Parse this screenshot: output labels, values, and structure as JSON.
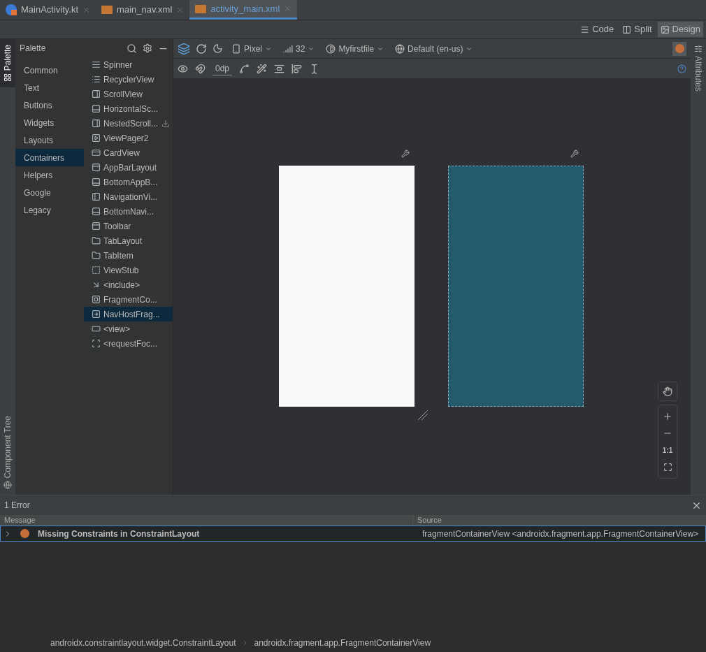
{
  "editor_tabs": [
    {
      "label": "MainActivity.kt",
      "kind": "kotlin",
      "selected": false
    },
    {
      "label": "main_nav.xml",
      "kind": "xml",
      "selected": false
    },
    {
      "label": "activity_main.xml",
      "kind": "xml",
      "selected": true
    }
  ],
  "view_modes": [
    {
      "label": "Code",
      "kind": "code",
      "selected": false
    },
    {
      "label": "Split",
      "kind": "split",
      "selected": false
    },
    {
      "label": "Design",
      "kind": "design",
      "selected": true
    }
  ],
  "left_tool_tabs": [
    {
      "label": "Palette",
      "kind": "palette",
      "selected": true
    },
    {
      "label": "Component Tree",
      "kind": "tree",
      "selected": false
    }
  ],
  "right_tool_tabs": [
    {
      "label": "Attributes",
      "selected": false
    }
  ],
  "palette": {
    "title": "Palette",
    "categories": [
      {
        "label": "Common",
        "selected": false
      },
      {
        "label": "Text",
        "selected": false
      },
      {
        "label": "Buttons",
        "selected": false
      },
      {
        "label": "Widgets",
        "selected": false
      },
      {
        "label": "Layouts",
        "selected": false
      },
      {
        "label": "Containers",
        "selected": true
      },
      {
        "label": "Helpers",
        "selected": false
      },
      {
        "label": "Google",
        "selected": false
      },
      {
        "label": "Legacy",
        "selected": false
      }
    ],
    "items": [
      {
        "label": "Spinner",
        "kind": "spinner",
        "selected": false,
        "download": false
      },
      {
        "label": "RecyclerView",
        "kind": "list",
        "selected": false,
        "download": false
      },
      {
        "label": "ScrollView",
        "kind": "scroll",
        "selected": false,
        "download": false
      },
      {
        "label": "HorizontalSc...",
        "kind": "hscroll",
        "selected": false,
        "download": false
      },
      {
        "label": "NestedScroll...",
        "kind": "scroll",
        "selected": false,
        "download": true
      },
      {
        "label": "ViewPager2",
        "kind": "pager",
        "selected": false,
        "download": false
      },
      {
        "label": "CardView",
        "kind": "card",
        "selected": false,
        "download": false
      },
      {
        "label": "AppBarLayout",
        "kind": "appbar",
        "selected": false,
        "download": false
      },
      {
        "label": "BottomAppB...",
        "kind": "bottombar",
        "selected": false,
        "download": false
      },
      {
        "label": "NavigationVi...",
        "kind": "navview",
        "selected": false,
        "download": false
      },
      {
        "label": "BottomNavi...",
        "kind": "bottombar",
        "selected": false,
        "download": false
      },
      {
        "label": "Toolbar",
        "kind": "appbar",
        "selected": false,
        "download": false
      },
      {
        "label": "TabLayout",
        "kind": "tab",
        "selected": false,
        "download": false
      },
      {
        "label": "TabItem",
        "kind": "tab",
        "selected": false,
        "download": false
      },
      {
        "label": "ViewStub",
        "kind": "stub",
        "selected": false,
        "download": false
      },
      {
        "label": "<include>",
        "kind": "include",
        "selected": false,
        "download": false
      },
      {
        "label": "FragmentCo...",
        "kind": "fragment",
        "selected": false,
        "download": false
      },
      {
        "label": "NavHostFrag...",
        "kind": "navhost",
        "selected": true,
        "download": false
      },
      {
        "label": "<view>",
        "kind": "view",
        "selected": false,
        "download": false
      },
      {
        "label": "<requestFoc...",
        "kind": "focus",
        "selected": false,
        "download": false
      }
    ]
  },
  "toolbar": {
    "device": "Pixel",
    "api": "32",
    "theme": "Myfirstfile",
    "locale": "Default (en-us)",
    "margin": "0dp"
  },
  "zoom_controls": {
    "actual_size": "1:1"
  },
  "problems": {
    "title": "1 Error",
    "columns": [
      "Message",
      "Source"
    ],
    "rows": [
      {
        "kind": "error",
        "message": "Missing Constraints in ConstraintLayout",
        "source": "fragmentContainerView <androidx.fragment.app.FragmentContainerView>",
        "selected": true
      }
    ]
  },
  "breadcrumb": [
    "androidx.constraintlayout.widget.ConstraintLayout",
    "androidx.fragment.app.FragmentContainerView"
  ]
}
